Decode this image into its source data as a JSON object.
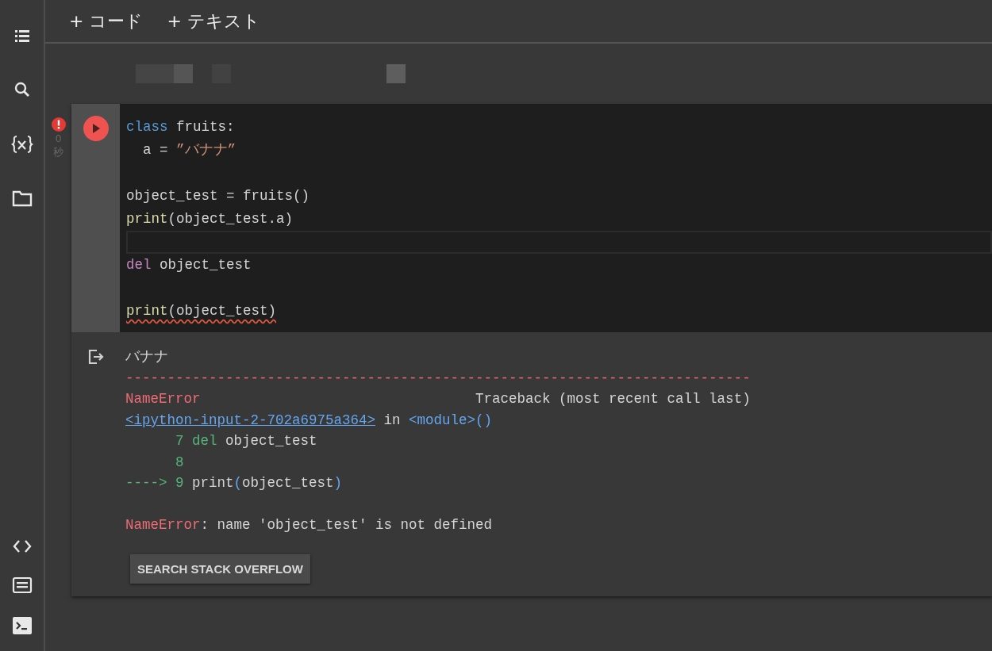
{
  "sidebar": {
    "items": [
      {
        "kind": "toc"
      },
      {
        "kind": "search"
      },
      {
        "kind": "variables"
      },
      {
        "kind": "files"
      }
    ],
    "bottom_items": [
      {
        "kind": "code"
      },
      {
        "kind": "palette"
      },
      {
        "kind": "terminal"
      }
    ]
  },
  "toolbar": {
    "buttons": [
      {
        "label": "+ コード"
      },
      {
        "label": "+ テキスト"
      }
    ]
  },
  "cell": {
    "status": {
      "error": true,
      "time": "0",
      "unit": "秒"
    },
    "code_lines": [
      {
        "tokens": [
          {
            "text": "class",
            "kind": "keyword"
          },
          {
            "text": " fruits:",
            "kind": "plain"
          }
        ]
      },
      {
        "tokens": [
          {
            "text": "  a = ",
            "kind": "plain"
          },
          {
            "text": "”バナナ”",
            "kind": "string"
          }
        ]
      },
      {
        "tokens": [
          {
            "text": "object_test = fruits()",
            "kind": "plain"
          }
        ],
        "blank_before": true
      },
      {
        "tokens": [
          {
            "text": "print",
            "kind": "builtin"
          },
          {
            "text": "(object_test.a)",
            "kind": "plain"
          }
        ]
      },
      {
        "current": true
      },
      {
        "tokens": [
          {
            "text": "del",
            "kind": "control"
          },
          {
            "text": " object_test",
            "kind": "plain"
          }
        ]
      },
      {
        "tokens": [
          {
            "text": "print",
            "kind": "builtin"
          },
          {
            "text": "(object_test)",
            "kind": "plain"
          }
        ],
        "error_underline": true,
        "blank_before": true
      }
    ],
    "output_lines": [
      {
        "tokens": [
          {
            "text": "バナナ",
            "kind": "plain"
          }
        ]
      },
      {
        "tokens": [
          {
            "text": "---------------------------------------------------------------------------",
            "kind": "error"
          }
        ]
      },
      {
        "tokens": [
          {
            "text": "NameError",
            "kind": "error"
          },
          {
            "text": "                                 Traceback (most recent call last)",
            "kind": "plain"
          }
        ]
      },
      {
        "tokens": [
          {
            "text": "<ipython-input-2-702a6975a364>",
            "kind": "link"
          },
          {
            "text": " in ",
            "kind": "plain"
          },
          {
            "text": "<module>()",
            "kind": "blue"
          }
        ]
      },
      {
        "tokens": [
          {
            "text": "      7 del",
            "kind": "green"
          },
          {
            "text": " object_test",
            "kind": "plain"
          }
        ]
      },
      {
        "tokens": [
          {
            "text": "      8",
            "kind": "green"
          }
        ]
      },
      {
        "tokens": [
          {
            "text": "----> 9",
            "kind": "green"
          },
          {
            "text": " print",
            "kind": "plain"
          },
          {
            "text": "(",
            "kind": "blue"
          },
          {
            "text": "object_test",
            "kind": "plain"
          },
          {
            "text": ")",
            "kind": "blue"
          }
        ]
      },
      {
        "tokens": [
          {
            "text": "NameError",
            "kind": "error"
          },
          {
            "text": ": name 'object_test' is not defined",
            "kind": "plain"
          }
        ],
        "blank_before": true
      }
    ],
    "action_button": "SEARCH STACK OVERFLOW"
  }
}
